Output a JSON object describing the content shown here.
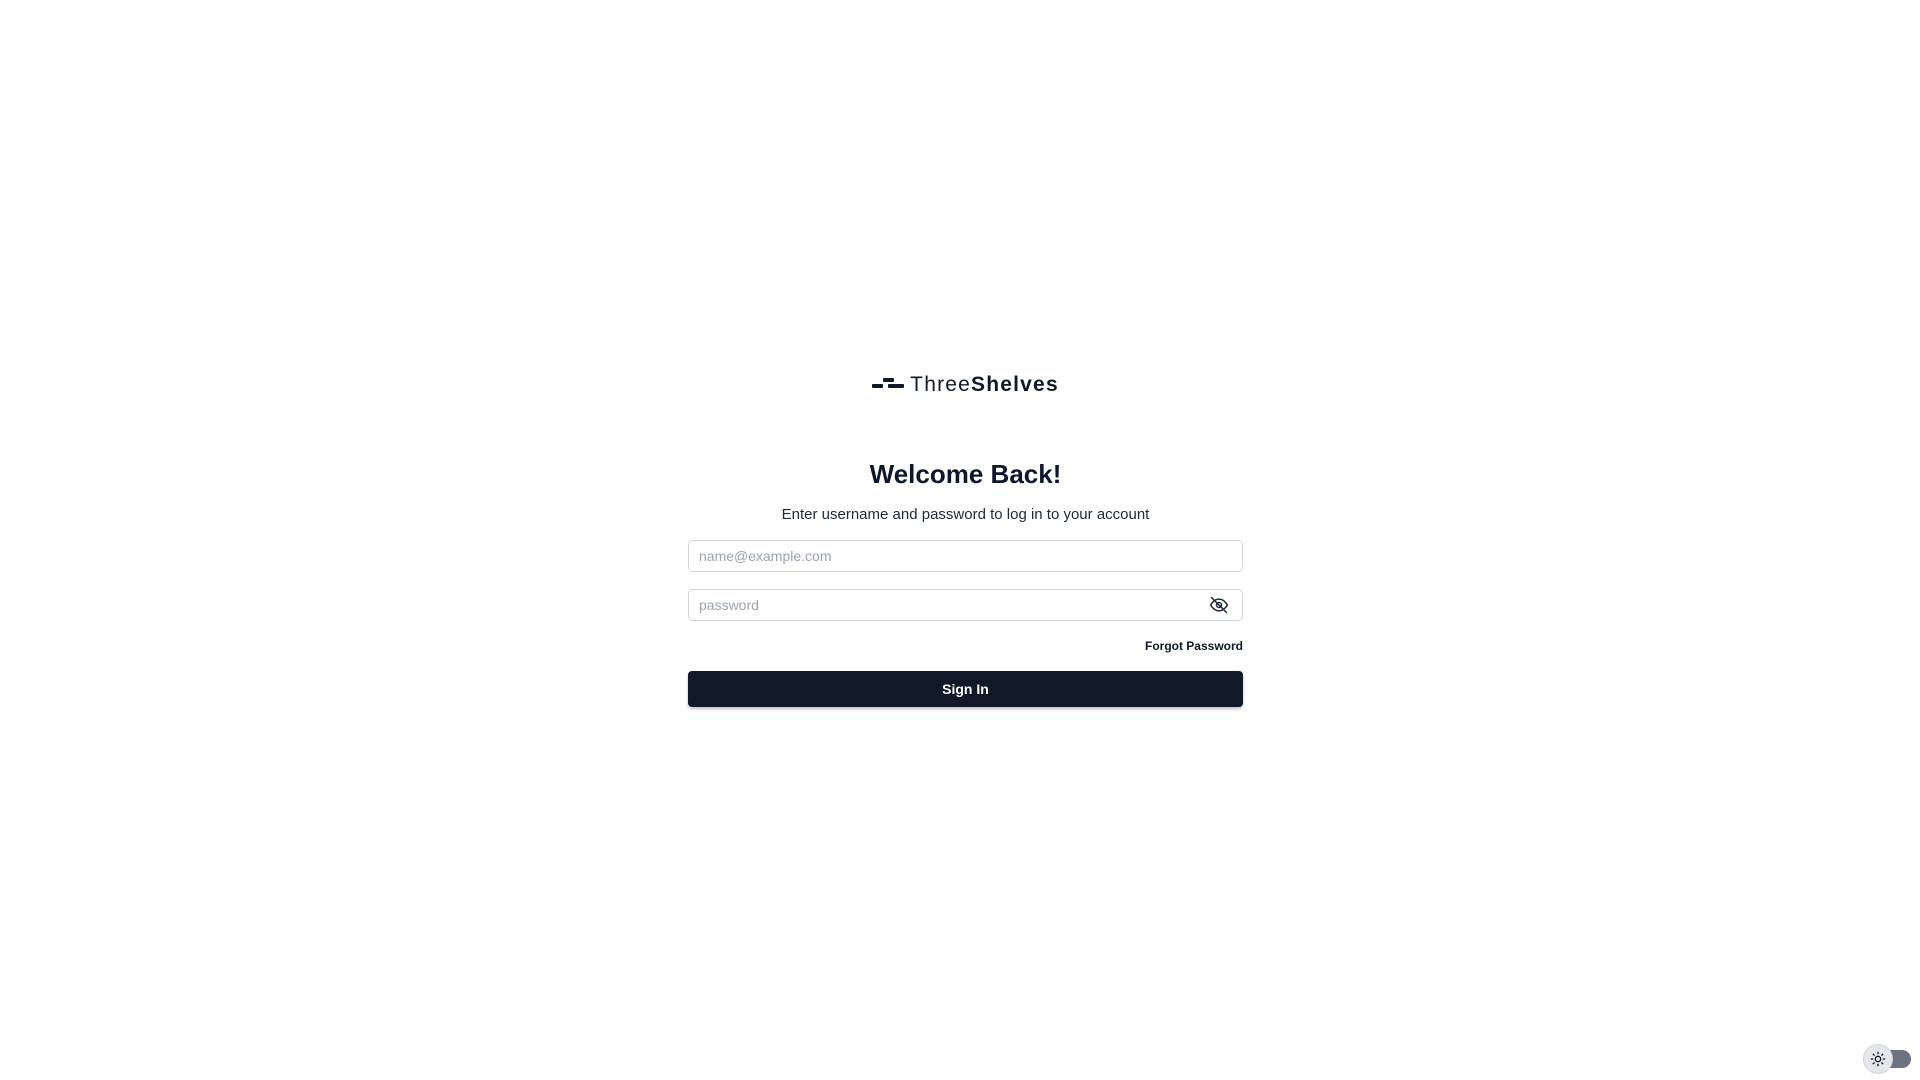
{
  "brand": {
    "name_part1": "Three",
    "name_part2": "Shelves"
  },
  "login": {
    "title": "Welcome Back!",
    "subtitle": "Enter username and password to log in to your account",
    "email_placeholder": "name@example.com",
    "email_value": "",
    "password_placeholder": "password",
    "password_value": "",
    "forgot_label": "Forgot Password",
    "signin_label": "Sign In"
  },
  "theme": {
    "mode": "light",
    "icon": "sun-icon"
  },
  "colors": {
    "primary": "#111827",
    "border": "#d1d5db",
    "placeholder": "#9ca3af",
    "background": "#ffffff"
  }
}
